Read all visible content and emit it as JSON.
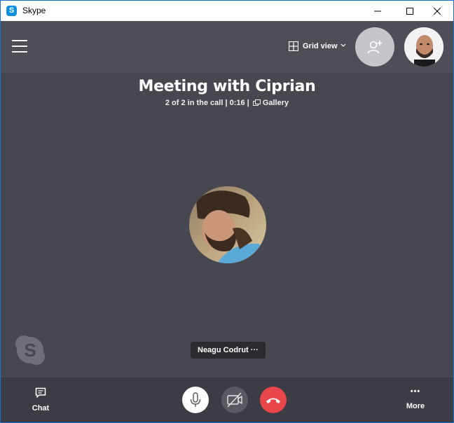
{
  "window": {
    "title": "Skype",
    "app_icon_letter": "S",
    "controls": [
      "minimize",
      "maximize",
      "close"
    ]
  },
  "toolbar": {
    "view_label": "Grid view",
    "view_icon": "grid-icon",
    "add_people_icon": "add-person-icon"
  },
  "meeting": {
    "title": "Meeting with Ciprian",
    "info_prefix": "2 of 2 in the call | 0:16 |",
    "gallery_label": "Gallery"
  },
  "participant": {
    "name_tag": "Neagu Codrut ···"
  },
  "bottom": {
    "chat_label": "Chat",
    "more_label": "More",
    "more_icon_text": "•••"
  },
  "colors": {
    "accent": "#0f8fe0",
    "hangup": "#e8464b",
    "background": "#47484f"
  }
}
